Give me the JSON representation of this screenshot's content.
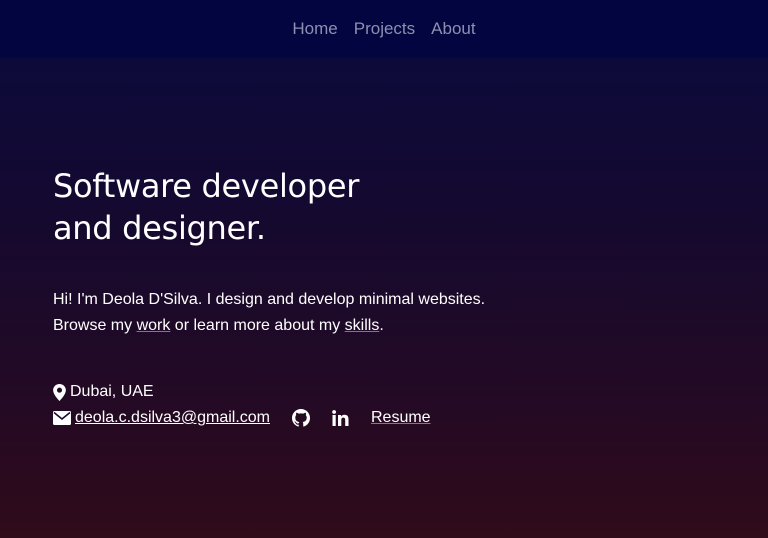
{
  "nav": {
    "items": [
      {
        "label": "Home"
      },
      {
        "label": "Projects"
      },
      {
        "label": "About"
      }
    ]
  },
  "hero": {
    "headline_line1": "Software developer",
    "headline_line2": "and designer.",
    "intro_line1": "Hi! I'm Deola D'Silva. I design and develop minimal websites.",
    "intro_prefix": "Browse my ",
    "work_link": "work",
    "intro_middle": " or learn more about my ",
    "skills_link": "skills",
    "intro_suffix": "."
  },
  "contact": {
    "location": "Dubai, UAE",
    "email": "deola.c.dsilva3@gmail.com",
    "resume_label": "Resume",
    "icons": [
      "map-pin-icon",
      "envelope-icon",
      "github-icon",
      "linkedin-icon"
    ]
  },
  "colors": {
    "navbar_bg": "#02053f",
    "nav_text": "#8d8fb0",
    "gradient_top": "#0d0a3a",
    "gradient_bottom": "#300b1a",
    "text": "#ffffff"
  }
}
